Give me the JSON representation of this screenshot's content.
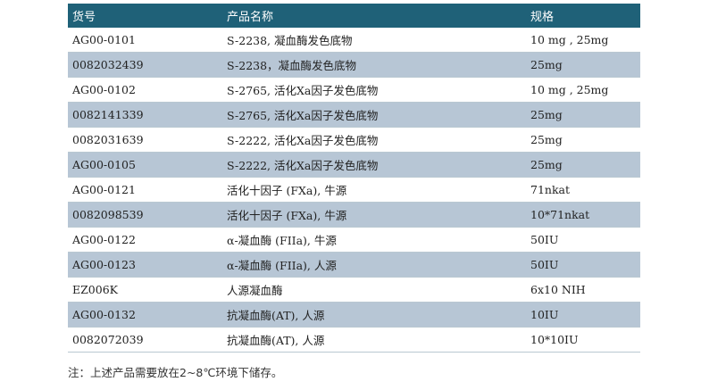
{
  "table": {
    "headers": [
      "货号",
      "产品名称",
      "规格"
    ],
    "rows": [
      {
        "code": "AG00-0101",
        "name": "S-2238, 凝血酶发色底物",
        "spec": "10 mg , 25mg"
      },
      {
        "code": "0082032439",
        "name": "S-2238，凝血酶发色底物",
        "spec": "25mg"
      },
      {
        "code": "AG00-0102",
        "name": "S-2765, 活化Xa因子发色底物",
        "spec": "10 mg , 25mg"
      },
      {
        "code": "0082141339",
        "name": "S-2765, 活化Xa因子发色底物",
        "spec": "25mg"
      },
      {
        "code": "0082031639",
        "name": "S-2222, 活化Xa因子发色底物",
        "spec": "25mg"
      },
      {
        "code": "AG00-0105",
        "name": "S-2222, 活化Xa因子发色底物",
        "spec": "25mg"
      },
      {
        "code": "AG00-0121",
        "name": "活化十因子 (FXa), 牛源",
        "spec": "71nkat"
      },
      {
        "code": "0082098539",
        "name": "活化十因子 (FXa), 牛源",
        "spec": "10*71nkat"
      },
      {
        "code": "AG00-0122",
        "name": "α-凝血酶 (FIIa), 牛源",
        "spec": "50IU"
      },
      {
        "code": "AG00-0123",
        "name": "α-凝血酶 (FIIa), 人源",
        "spec": "50IU"
      },
      {
        "code": "EZ006K",
        "name": "人源凝血酶",
        "spec": "6x10 NIH"
      },
      {
        "code": "AG00-0132",
        "name": "抗凝血酶(AT), 人源",
        "spec": "10IU"
      },
      {
        "code": "0082072039",
        "name": "抗凝血酶(AT), 人源",
        "spec": "10*10IU"
      }
    ]
  },
  "note": "注：上述产品需要放在2~8℃环境下储存。",
  "colors": {
    "header_bg": "#1f6178",
    "stripe": "#b7c6d5"
  }
}
